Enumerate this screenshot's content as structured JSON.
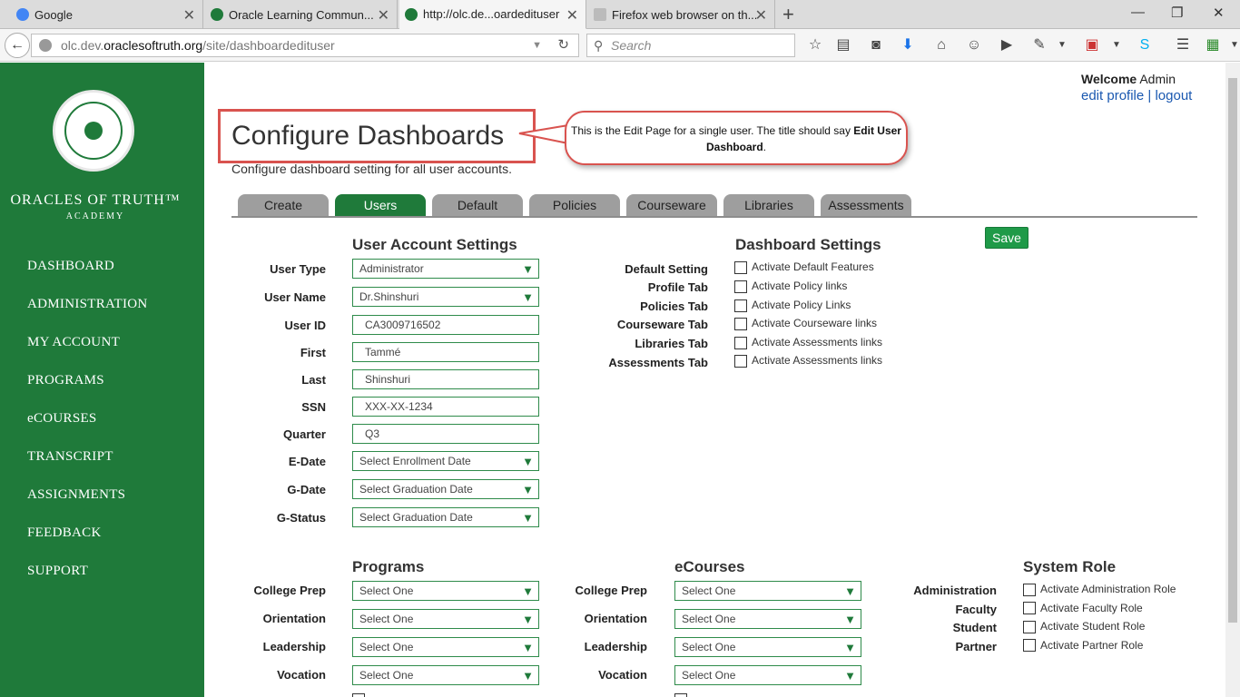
{
  "browser": {
    "tabs": [
      {
        "title": "Google"
      },
      {
        "title": "Oracle Learning Commun..."
      },
      {
        "title": "http://olc.de...oardedituser"
      },
      {
        "title": "Firefox web browser on th..."
      }
    ],
    "url": {
      "prefix": "olc.dev.",
      "host": "oraclesoftruth.org",
      "path": "/site/dashboardedituser"
    },
    "search_placeholder": "Search"
  },
  "site": {
    "brand": {
      "name": "ORACLES OF TRUTH™",
      "sub": "ACADEMY"
    },
    "nav": [
      "DASHBOARD",
      "ADMINISTRATION",
      "MY ACCOUNT",
      "PROGRAMS",
      "eCOURSES",
      "TRANSCRIPT",
      "ASSIGNMENTS",
      "FEEDBACK",
      "SUPPORT"
    ]
  },
  "header": {
    "welcome_label": "Welcome",
    "user": "Admin",
    "edit_profile": "edit profile",
    "separator": "|",
    "logout": "logout"
  },
  "page": {
    "title": "Configure Dashboards",
    "subtitle": "Configure dashboard setting for all user accounts.",
    "callout": {
      "text": "This is the Edit Page for a single user. The title should say",
      "bold": "Edit User Dashboard",
      "end": "."
    }
  },
  "tabs": [
    "Create",
    "Users",
    "Default",
    "Policies",
    "Courseware",
    "Libraries",
    "Assessments"
  ],
  "save_label": "Save",
  "user_account": {
    "heading": "User Account Settings",
    "fields": [
      {
        "label": "User Type",
        "value": "Administrator"
      },
      {
        "label": "User Name",
        "value": "Dr.Shinshuri"
      },
      {
        "label": "User ID",
        "value": "CA3009716502"
      },
      {
        "label": "First",
        "value": "Tammé"
      },
      {
        "label": "Last",
        "value": "Shinshuri"
      },
      {
        "label": "SSN",
        "value": "XXX-XX-1234"
      },
      {
        "label": "Quarter",
        "value": "Q3"
      },
      {
        "label": "E-Date",
        "value": "Select Enrollment Date"
      },
      {
        "label": "G-Date",
        "value": "Select Graduation Date"
      },
      {
        "label": "G-Status",
        "value": "Select Graduation Date"
      }
    ]
  },
  "dashboard_settings": {
    "heading": "Dashboard Settings",
    "items": [
      {
        "label": "Default Setting",
        "option": "Activate Default Features"
      },
      {
        "label": "Profile Tab",
        "option": "Activate Policy links"
      },
      {
        "label": "Policies Tab",
        "option": "Activate Policy Links"
      },
      {
        "label": "Courseware Tab",
        "option": "Activate Courseware links"
      },
      {
        "label": "Libraries Tab",
        "option": "Activate Assessments links"
      },
      {
        "label": "Assessments Tab",
        "option": "Activate Assessments links"
      }
    ]
  },
  "programs": {
    "heading": "Programs",
    "rows": [
      {
        "label": "College Prep",
        "value": "Select One"
      },
      {
        "label": "Orientation",
        "value": "Select One"
      },
      {
        "label": "Leadership",
        "value": "Select One"
      },
      {
        "label": "Vocation",
        "value": "Select One"
      }
    ]
  },
  "ecourses": {
    "heading": "eCourses",
    "rows": [
      {
        "label": "College Prep",
        "value": "Select One"
      },
      {
        "label": "Orientation",
        "value": "Select One"
      },
      {
        "label": "Leadership",
        "value": "Select One"
      },
      {
        "label": "Vocation",
        "value": "Select One"
      }
    ]
  },
  "system_role": {
    "heading": "System Role",
    "items": [
      {
        "label": "Administration",
        "option": "Activate Administration Role"
      },
      {
        "label": "Faculty",
        "option": "Activate Faculty Role"
      },
      {
        "label": "Student",
        "option": "Activate Student Role"
      },
      {
        "label": "Partner",
        "option": "Activate Partner Role"
      }
    ]
  }
}
